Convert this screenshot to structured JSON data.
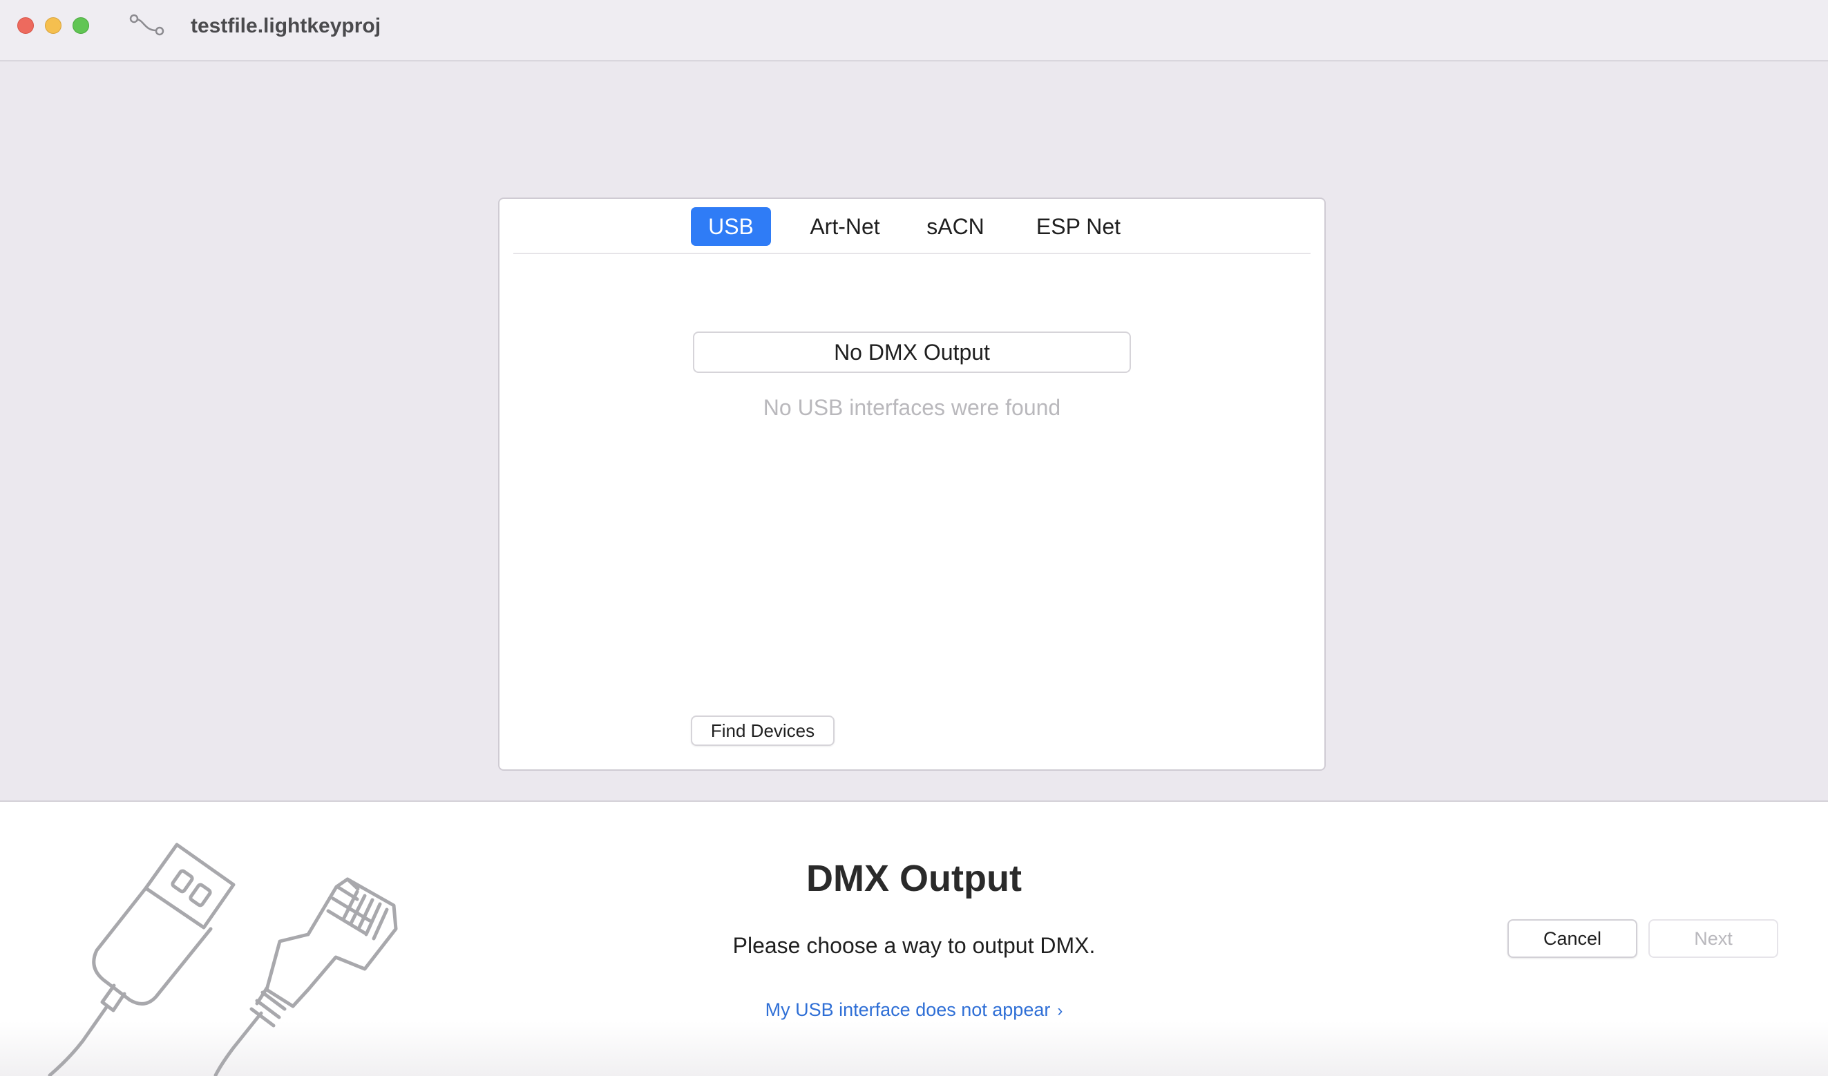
{
  "window": {
    "title": "testfile.lightkeyproj",
    "icon": "link-nodes-icon"
  },
  "tabs": [
    {
      "label": "USB",
      "selected": true
    },
    {
      "label": "Art-Net",
      "selected": false
    },
    {
      "label": "sACN",
      "selected": false
    },
    {
      "label": "ESP Net",
      "selected": false
    }
  ],
  "usb_panel": {
    "output_selection": "No DMX Output",
    "empty_message": "No USB interfaces were found",
    "find_devices_label": "Find Devices"
  },
  "footer": {
    "title": "DMX Output",
    "description": "Please choose a way to output DMX.",
    "help_link": "My USB interface does not appear",
    "help_link_chevron": "›",
    "cancel_label": "Cancel",
    "next_label": "Next",
    "next_enabled": false,
    "illustration": "usb-and-ethernet-cable-icon"
  },
  "colors": {
    "accent": "#2f7cf6",
    "link": "#2f6fd6",
    "traffic_close": "#ed6a5e",
    "traffic_minimize": "#f5bf4f",
    "traffic_zoom": "#61c554"
  }
}
